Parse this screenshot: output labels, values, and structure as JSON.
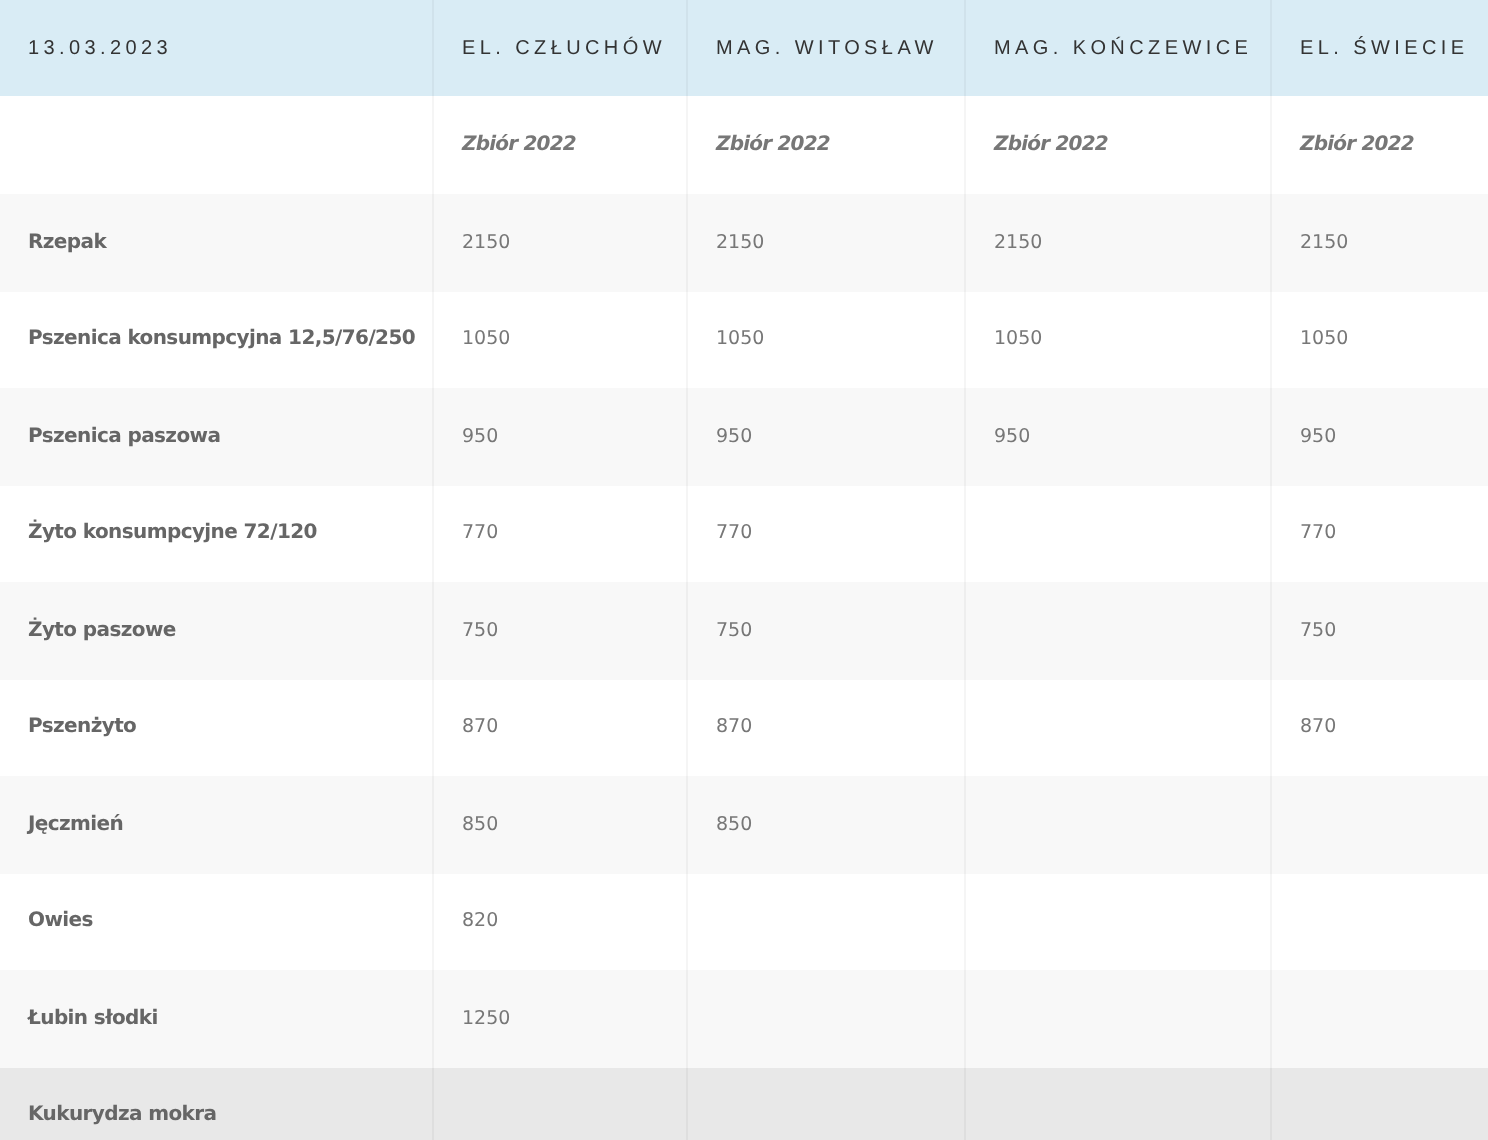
{
  "table": {
    "columns": [
      "13.03.2023",
      "EL. CZŁUCHÓW",
      "MAG. WITOSŁAW",
      "MAG. KOŃCZEWICE",
      "EL. ŚWIECIE"
    ],
    "subheader": [
      "Zbiór 2022",
      "Zbiór 2022",
      "Zbiór 2022",
      "Zbiór 2022"
    ],
    "rows": [
      {
        "name": "Rzepak",
        "prices": {
          "column_2": "2150",
          "column_3": "2150",
          "column_4": "2150",
          "column_5": "2150"
        },
        "hovered": false
      },
      {
        "name": "Pszenica konsumpcyjna 12,5/76/250",
        "prices": {
          "column_2": "1050",
          "column_3": "1050",
          "column_4": "1050",
          "column_5": "1050"
        },
        "hovered": false
      },
      {
        "name": "Pszenica paszowa",
        "prices": {
          "column_2": "950",
          "column_3": "950",
          "column_4": "950",
          "column_5": "950"
        },
        "hovered": false
      },
      {
        "name": "Żyto konsumpcyjne 72/120",
        "prices": {
          "column_2": "770",
          "column_3": "770",
          "column_5": "770"
        },
        "hovered": false
      },
      {
        "name": "Żyto paszowe",
        "prices": {
          "column_2": "750",
          "column_3": "750",
          "column_5": "750"
        },
        "hovered": false
      },
      {
        "name": "Pszenżyto",
        "prices": {
          "column_2": "870",
          "column_3": "870",
          "column_5": "870"
        },
        "hovered": false
      },
      {
        "name": "Jęczmień",
        "prices": {
          "column_2": "850",
          "column_3": "850"
        },
        "hovered": false
      },
      {
        "name": "Owies",
        "prices": {
          "column_2": "820"
        },
        "hovered": false
      },
      {
        "name": "Łubin słodki",
        "prices": {
          "column_2": "1250"
        },
        "hovered": false
      },
      {
        "name": "Kukurydza mokra",
        "hovered": true
      }
    ]
  }
}
